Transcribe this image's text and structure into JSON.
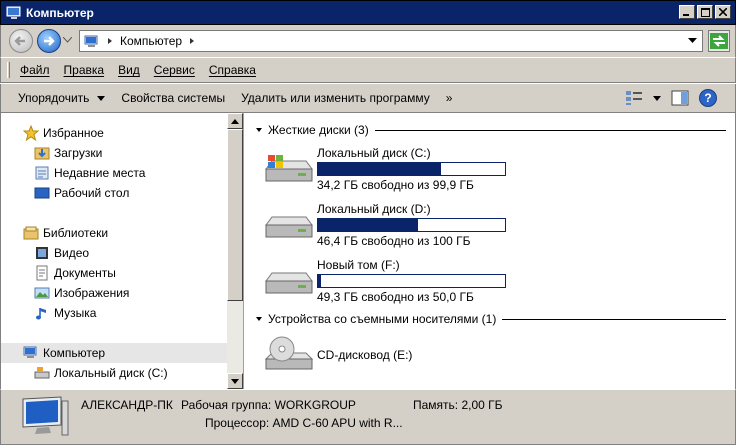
{
  "window": {
    "title": "Компьютер"
  },
  "address": {
    "crumb": "Компьютер"
  },
  "menu": {
    "items": [
      "Файл",
      "Правка",
      "Вид",
      "Сервис",
      "Справка"
    ]
  },
  "commands": {
    "items": [
      "Упорядочить",
      "Свойства системы",
      "Удалить или изменить программу"
    ],
    "overflow": "»",
    "help": "?"
  },
  "nav": {
    "items": [
      {
        "label": "Избранное",
        "icon": "star-icon"
      },
      {
        "label": "Загрузки",
        "icon": "downloads-folder-icon"
      },
      {
        "label": "Недавние места",
        "icon": "recent-places-icon"
      },
      {
        "label": "Рабочий стол",
        "icon": "desktop-icon"
      },
      {
        "label": "Библиотеки",
        "icon": "libraries-icon"
      },
      {
        "label": "Видео",
        "icon": "video-library-icon"
      },
      {
        "label": "Документы",
        "icon": "documents-library-icon"
      },
      {
        "label": "Изображения",
        "icon": "pictures-library-icon"
      },
      {
        "label": "Музыка",
        "icon": "music-library-icon"
      },
      {
        "label": "Компьютер",
        "icon": "computer-icon"
      },
      {
        "label": "Локальный диск (C:)",
        "icon": "drive-icon"
      }
    ]
  },
  "main": {
    "groups": {
      "hard_drives": "Жесткие диски (3)",
      "removable": "Устройства со съемными носителями (1)"
    },
    "drives": [
      {
        "name": "Локальный диск (C:)",
        "free": "34,2 ГБ свободно из 99,9 ГБ",
        "used_fraction": 0.658,
        "system": true
      },
      {
        "name": "Локальный диск (D:)",
        "free": "46,4 ГБ свободно из 100 ГБ",
        "used_fraction": 0.536,
        "system": false
      },
      {
        "name": "Новый том (F:)",
        "free": "49,3 ГБ свободно из 50,0 ГБ",
        "used_fraction": 0.014,
        "system": false
      }
    ],
    "cd": {
      "name": "CD-дисковод (E:)"
    }
  },
  "status": {
    "computer_name": "АЛЕКСАНДР-ПК",
    "workgroup": "Рабочая группа: WORKGROUP",
    "memory": "Память: 2,00 ГБ",
    "processor": "Процессор: AMD C-60 APU with R..."
  },
  "colors": {
    "titlebar": "#0a246a",
    "chrome": "#d4d0c8",
    "bar_fill": "#0a246a",
    "selection": "#e6e6e6"
  }
}
